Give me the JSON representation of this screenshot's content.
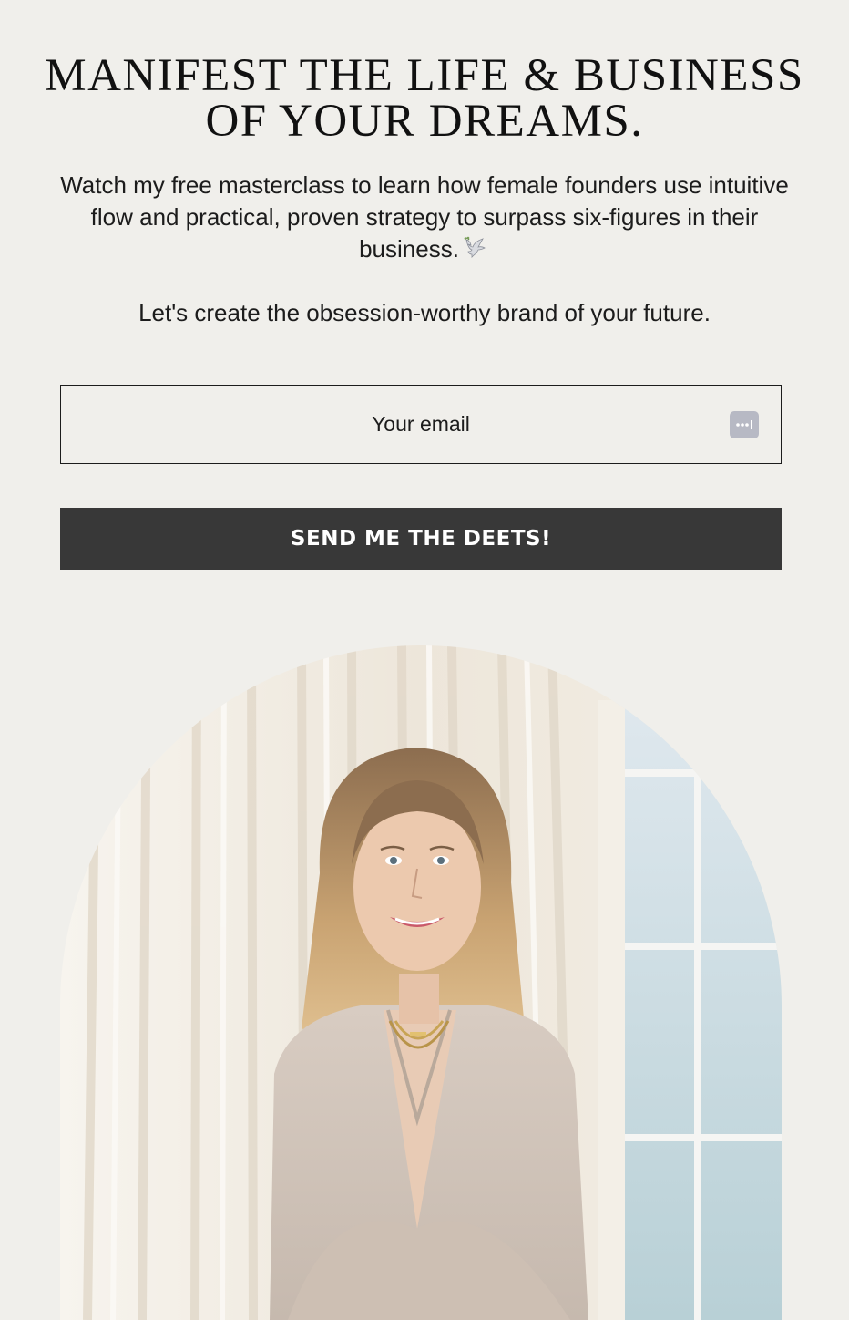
{
  "hero": {
    "headline": "MANIFEST THE LIFE & BUSINESS OF YOUR DREAMS.",
    "intro": "Watch my free masterclass to learn how female founders use intuitive flow and practical, proven strategy to surpass six-figures in their business.",
    "tagline": "Let's create the obsession-worthy brand of your future."
  },
  "form": {
    "email_placeholder": "Your email",
    "submit_label": "SEND ME THE DEETS!"
  },
  "icons": {
    "dove": "dove-icon",
    "password_manager": "password-manager-icon"
  },
  "colors": {
    "background": "#f0efeb",
    "button": "#383838",
    "button_text": "#ffffff",
    "text": "#1c1c1c"
  }
}
